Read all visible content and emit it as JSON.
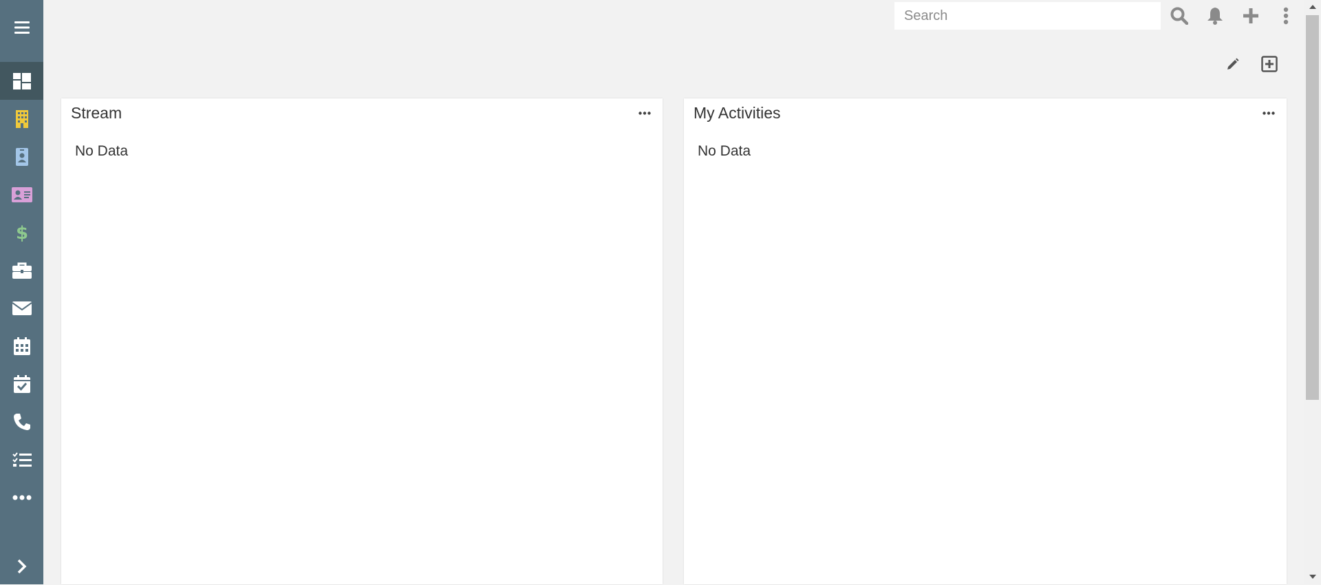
{
  "search": {
    "placeholder": "Search"
  },
  "sidebar": {
    "items": [
      {
        "icon": "hamburger-icon"
      },
      {
        "icon": "dashboard-icon",
        "active": true
      },
      {
        "icon": "building-icon",
        "color": "#f0c93b"
      },
      {
        "icon": "contact-badge-icon",
        "color": "#a3c6e8"
      },
      {
        "icon": "id-card-icon",
        "color": "#d9a0d8"
      },
      {
        "icon": "dollar-icon",
        "color": "#8ec98e"
      },
      {
        "icon": "briefcase-icon"
      },
      {
        "icon": "envelope-icon"
      },
      {
        "icon": "calendar-icon"
      },
      {
        "icon": "calendar-check-icon"
      },
      {
        "icon": "phone-icon"
      },
      {
        "icon": "tasks-icon"
      },
      {
        "icon": "more-icon"
      },
      {
        "icon": "chevron-right-icon"
      }
    ]
  },
  "topbar": {
    "icons": [
      "search-icon",
      "bell-icon",
      "plus-icon",
      "vertical-dots-icon"
    ]
  },
  "dashboard": {
    "actions": [
      "pencil-icon",
      "plus-square-icon"
    ],
    "panels": [
      {
        "title": "Stream",
        "empty_text": "No Data"
      },
      {
        "title": "My Activities",
        "empty_text": "No Data"
      }
    ]
  },
  "colors": {
    "sidebar_bg": "#56707f",
    "sidebar_active": "#42575f",
    "page_bg": "#f2f2f2"
  }
}
